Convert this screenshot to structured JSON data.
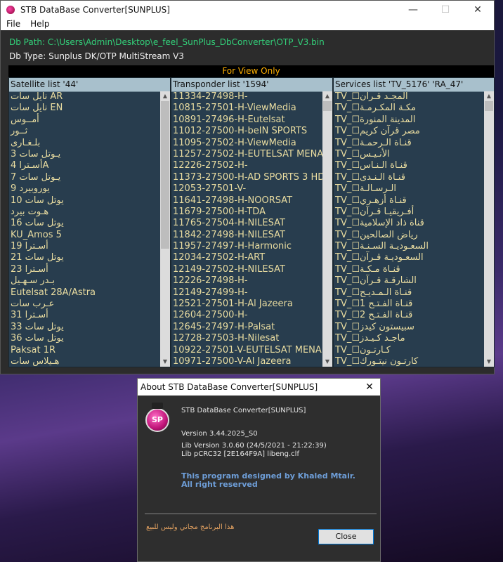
{
  "window": {
    "title": "STB DataBase Converter[SUNPLUS]",
    "minimize": "—",
    "maximize": "☐",
    "close": "✕"
  },
  "menu": [
    "File",
    "Help"
  ],
  "db_path": "Db Path: C:\\Users\\Admin\\Desktop\\e_feel_SunPlus_DbConverter\\OTP_V3.bin",
  "db_type": "Db Type: Sunplus DK/OTP MultiStream V3",
  "banner": "For View Only",
  "satellite": {
    "header": "Satellite list '44'",
    "items": [
      "نايل سات AR",
      "نايل سات EN",
      "أمــوس",
      "ثــور",
      "بلـغـارى",
      "يـوتل سات 3",
      "أسـترا 4A",
      "يـوتل سات 7",
      "يوروبيرد 9",
      "يوتل سات 10",
      "هـوت بيرد",
      "يوتل سات 16",
      "KU_Amos 5",
      "أسـترا 19",
      "يوتل سات 21",
      "أسـترا 23",
      "بـدر سـهـيل",
      "Eutelsat 28A/Astra",
      "عـرب سات",
      "أسـترا 31",
      "يوتل سات 33",
      "يوتل سات 36",
      "Paksat 1R",
      "هـيلاس سات"
    ]
  },
  "transponder": {
    "header": "Transponder list '1594'",
    "items": [
      "11334-27498-H-",
      "10815-27501-H-ViewMedia",
      "10891-27496-H-Eutelsat",
      "11012-27500-H-beIN SPORTS",
      "11095-27502-H-ViewMedia",
      "11257-27502-H-EUTELSAT MENA",
      "12226-27502-H-",
      "11373-27500-H-AD SPORTS 3 HD",
      "12053-27501-V-",
      "11641-27498-H-NOORSAT",
      "11679-27500-H-TDA",
      "11765-27504-H-NILESAT",
      "11842-27498-H-NILESAT",
      "11957-27497-H-Harmonic",
      "12034-27502-H-ART",
      "12149-27502-H-NILESAT",
      "12226-27498-H-",
      "12149-27499-H-",
      "12521-27501-H-Al Jazeera",
      "12604-27500-H-",
      "12645-27497-H-Palsat",
      "12728-27503-H-Nilesat",
      "10922-27501-V-EUTELSAT MENA",
      "10971-27500-V-Al Jazeera"
    ]
  },
  "services": {
    "header": "Services list 'TV_5176' 'RA_47'",
    "items": [
      "TV_☐المجـد قـرآن",
      "TV_☐مكـة المكـرمـة",
      "TV_☐المدينة المنورة",
      "TV_☐مصر قرآن كريم",
      "TV_☐قنـاة الـرحمـة",
      "TV_☐الأنـيـس",
      "TV_☐قنـاة الـنـاس",
      "TV_☐قنـاة الـنـدى",
      "TV_☐الـرسـالـة",
      "TV_☐قنـاة أزهـري",
      "TV_☐أفـريقيـا قـرآن",
      "TV_☐قناة ذاد الإسلامية",
      "TV_☐رياض الصالحين",
      "TV_☐السعـوديـة السـنـة",
      "TV_☐السعـوديـة قـرآن",
      "TV_☐قنـاة مـكـة",
      "TV_☐الشارقـة قـرآن",
      "TV_☐قنـاة الـمـديـح",
      "TV_☐قنـاة الفـتـح 1",
      "TV_☐قنـاة الفـتـح 2",
      "TV_☐سبيستون كيدز",
      "TV_☐ماجـد كـيـدز",
      "TV_☐كـارتـون",
      "TV_☐كارتـون نيتـورك"
    ]
  },
  "about": {
    "title": "About STB DataBase Converter[SUNPLUS]",
    "close_x": "✕",
    "app_name": "STB DataBase Converter[SUNPLUS]",
    "version": "Version 3.44.2025_S0",
    "lib_version": "Lib Version 3.0.60 (24/5/2021 - 21:22:39)",
    "lib_crc": "Lib pCRC32 [2E164F9A] libeng.clf",
    "credit1": "This program designed by Khaled Mtair.",
    "credit2": "All right reserved",
    "arabic_note": "هذا البرنامج مجاني وليس للبيع",
    "close_button": "Close",
    "logo_text": "SP"
  }
}
